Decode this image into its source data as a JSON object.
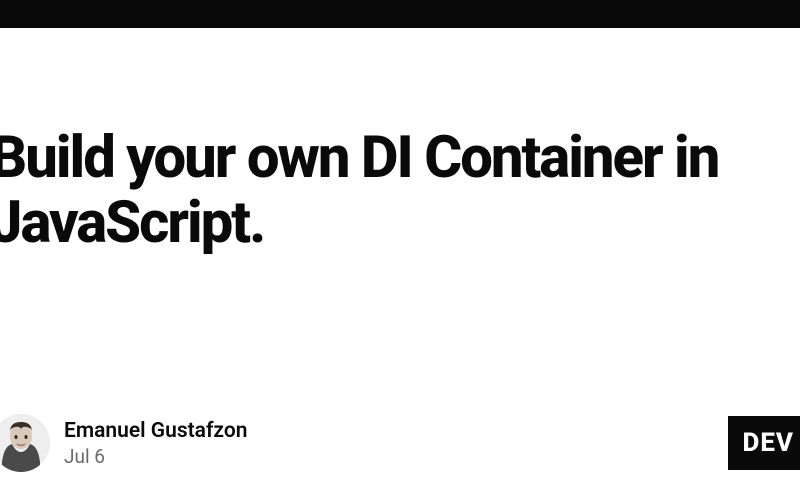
{
  "article": {
    "title": "Build your own DI Container in JavaScript."
  },
  "author": {
    "name": "Emanuel Gustafzon",
    "date": "Jul 6"
  },
  "brand": {
    "label": "DEV"
  }
}
